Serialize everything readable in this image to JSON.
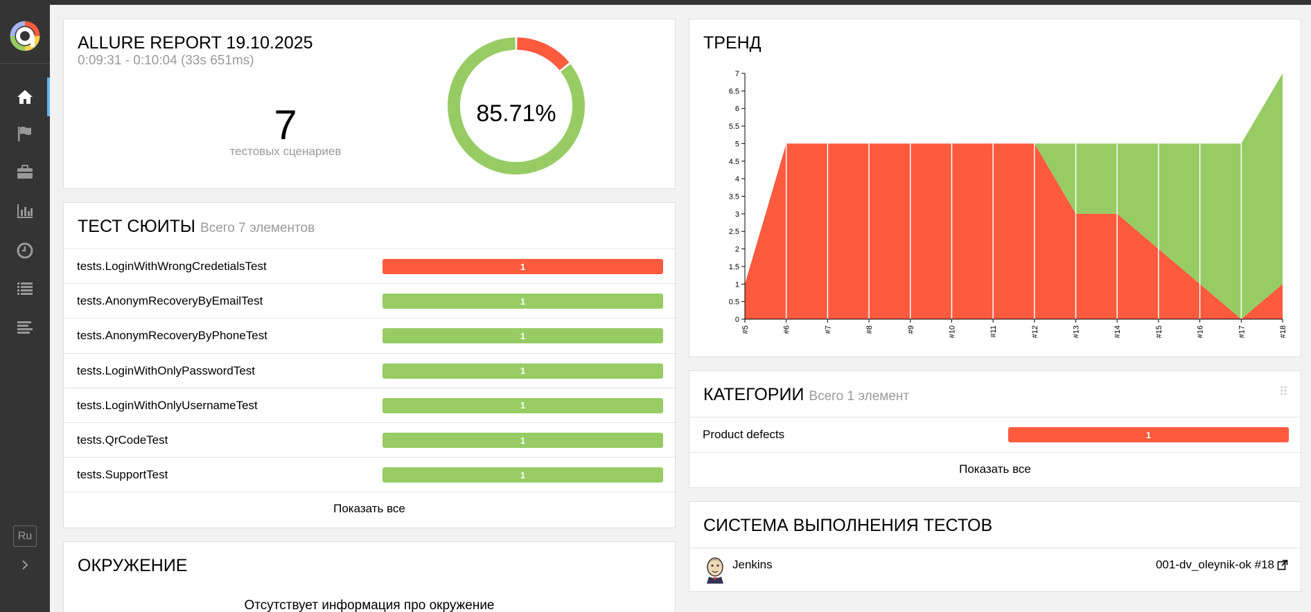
{
  "sidebar": {
    "nav": [
      {
        "icon": "home-icon",
        "active": true
      },
      {
        "icon": "flag-icon",
        "active": false
      },
      {
        "icon": "briefcase-icon",
        "active": false
      },
      {
        "icon": "bar-chart-icon",
        "active": false
      },
      {
        "icon": "clock-icon",
        "active": false
      },
      {
        "icon": "list-icon",
        "active": false
      },
      {
        "icon": "timeline-icon",
        "active": false
      }
    ],
    "lang": "Ru"
  },
  "summary": {
    "title": "ALLURE REPORT 19.10.2025",
    "time": "0:09:31 - 0:10:04 (33s 651ms)",
    "count": "7",
    "count_label": "тестовых сценариев",
    "percent": "85.71%",
    "passed": 6,
    "failed": 1
  },
  "suites": {
    "title": "ТЕСТ СЮИТЫ",
    "subtitle": "Всего 7 элементов",
    "items": [
      {
        "name": "tests.LoginWithWrongCredetialsTest",
        "count": "1",
        "status": "failed"
      },
      {
        "name": "tests.AnonymRecoveryByEmailTest",
        "count": "1",
        "status": "passed"
      },
      {
        "name": "tests.AnonymRecoveryByPhoneTest",
        "count": "1",
        "status": "passed"
      },
      {
        "name": "tests.LoginWithOnlyPasswordTest",
        "count": "1",
        "status": "passed"
      },
      {
        "name": "tests.LoginWithOnlyUsernameTest",
        "count": "1",
        "status": "passed"
      },
      {
        "name": "tests.QrCodeTest",
        "count": "1",
        "status": "passed"
      },
      {
        "name": "tests.SupportTest",
        "count": "1",
        "status": "passed"
      }
    ],
    "show_all": "Показать все"
  },
  "environment": {
    "title": "ОКРУЖЕНИЕ",
    "message": "Отсутствует информация про окружение"
  },
  "trend": {
    "title": "ТРЕНД"
  },
  "chart_data": {
    "type": "area",
    "title": "ТРЕНД",
    "x": [
      "#5",
      "#6",
      "#7",
      "#8",
      "#9",
      "#10",
      "#11",
      "#12",
      "#13",
      "#14",
      "#15",
      "#16",
      "#17",
      "#18"
    ],
    "series": [
      {
        "status": "failed",
        "color": "#fd5a3e",
        "values": [
          1,
          5,
          5,
          5,
          5,
          5,
          5,
          5,
          3,
          3,
          2,
          1,
          0,
          1
        ]
      },
      {
        "status": "passed",
        "color": "#97cc64",
        "values": [
          0,
          0,
          0,
          0,
          0,
          0,
          0,
          0,
          2,
          2,
          3,
          4,
          5,
          6
        ]
      }
    ],
    "stacked": true,
    "ylim": [
      0,
      7
    ],
    "yticks": [
      "0",
      "0.5",
      "1",
      "1.5",
      "2",
      "2.5",
      "3",
      "3.5",
      "4",
      "4.5",
      "5",
      "5.5",
      "6",
      "6.5",
      "7"
    ]
  },
  "categories": {
    "title": "КАТЕГОРИИ",
    "subtitle": "Всего 1 элемент",
    "items": [
      {
        "name": "Product defects",
        "count": "1",
        "status": "failed"
      }
    ],
    "show_all": "Показать все"
  },
  "executors": {
    "title": "СИСТЕМА ВЫПОЛНЕНИЯ ТЕСТОВ",
    "name": "Jenkins",
    "build": "001-dv_oleynik-ok #18"
  }
}
